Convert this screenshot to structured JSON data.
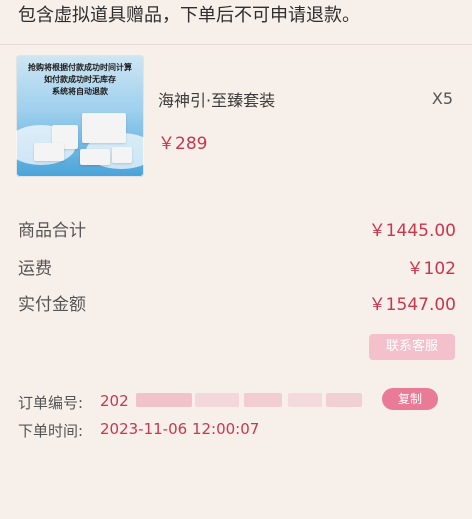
{
  "notice": {
    "text": "包含虚拟道具赠品，下单后不可申请退款。"
  },
  "product": {
    "thumbnail_text": [
      "抢购将根据付款成功时间计算",
      "如付款成功时无库存",
      "系统将自动退款"
    ],
    "name": "海神引·至臻套装",
    "quantity": "X5",
    "price": "￥289"
  },
  "summary": {
    "rows": [
      {
        "label": "商品合计",
        "value": "￥1445.00"
      },
      {
        "label": "运费",
        "value": "￥102"
      },
      {
        "label": "实付金额",
        "value": "￥1547.00"
      }
    ]
  },
  "actions": {
    "customer_service_label": "联系客服",
    "copy_label": "复制"
  },
  "order": {
    "number_label": "订单编号:",
    "number_value": "202",
    "time_label": "下单时间:",
    "time_value": "2023-11-06 12:00:07"
  },
  "colors": {
    "background": "#f7efe9",
    "price_red": "#c9374f",
    "copy_pink": "#e97b96",
    "service_pink": "#f4c0cc"
  }
}
